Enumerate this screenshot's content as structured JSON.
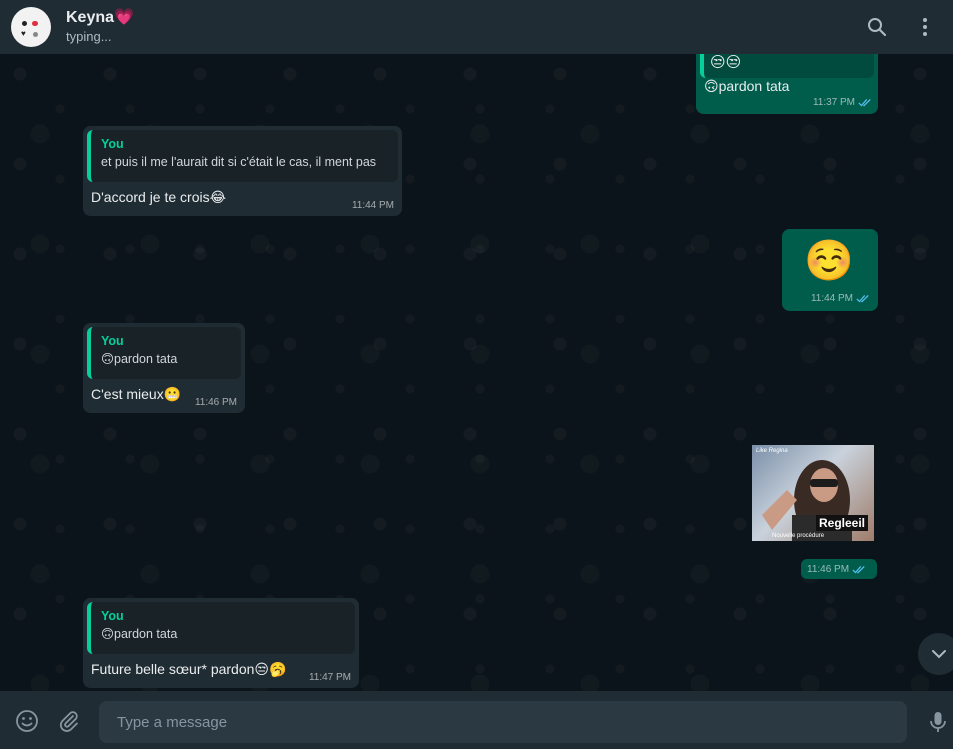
{
  "header": {
    "contact_name": "Keyna💗",
    "status": "typing..."
  },
  "colors": {
    "header_bg": "#202c33",
    "chat_bg": "#0b141a",
    "incoming_bubble": "#202c33",
    "outgoing_bubble": "#005c4b",
    "quote_accent": "#06cf9c",
    "read_ticks": "#53bdeb"
  },
  "messages": [
    {
      "direction": "out",
      "top_emoji": "😒😒",
      "text": "🙃pardon tata",
      "time": "11:37 PM",
      "ticks": "read"
    },
    {
      "direction": "in",
      "quote_author": "You",
      "quote_text": "et puis il me l'aurait dit si c'était le cas, il ment pas",
      "text": "D'accord je te crois😂",
      "time": "11:44 PM"
    },
    {
      "direction": "out",
      "emoji": "☺️",
      "time": "11:44 PM",
      "ticks": "read"
    },
    {
      "direction": "in",
      "quote_author": "You",
      "quote_text": "🙃pardon tata",
      "text": "C'est mieux😬",
      "time": "11:46 PM"
    },
    {
      "direction": "out",
      "sticker_caption": "Regleeil",
      "sticker_top": "Like Regina",
      "sticker_bottom": "Nouvelle procédure",
      "time": "11:46 PM",
      "ticks": "read"
    },
    {
      "direction": "in",
      "quote_author": "You",
      "quote_text": "🙃pardon tata",
      "text": "Future belle sœur* pardon😒🥱",
      "time": "11:47 PM"
    }
  ],
  "footer": {
    "placeholder": "Type a message"
  },
  "icons": [
    "search-icon",
    "menu-icon",
    "emoji-icon",
    "attach-icon",
    "mic-icon",
    "chevron-down-icon",
    "double-check-icon"
  ]
}
